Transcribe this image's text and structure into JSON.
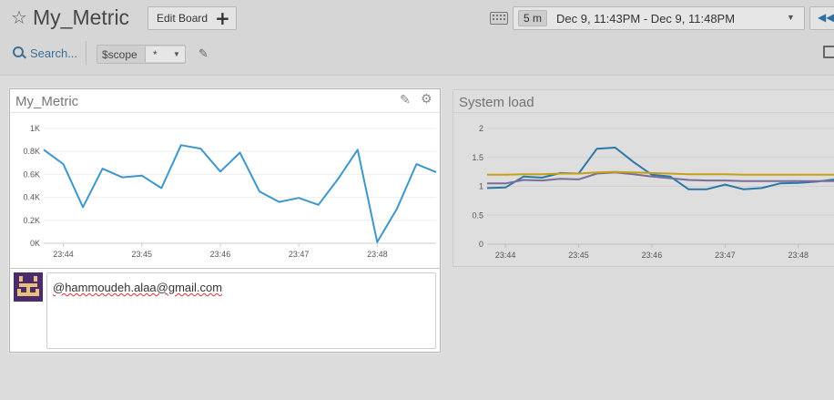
{
  "header": {
    "title": "My_Metric",
    "edit_board_label": "Edit Board",
    "time": {
      "duration": "5 m",
      "range": "Dec 9, 11:43PM - Dec 9, 11:48PM"
    }
  },
  "toolbar": {
    "search_label": "Search...",
    "template_var": {
      "name": "$scope",
      "value": "*"
    }
  },
  "widgets": [
    {
      "title": "My_Metric",
      "comment": {
        "text": "@hammoudeh.alaa@gmail.com"
      }
    },
    {
      "title": "System load"
    }
  ],
  "colors": {
    "line": "#3d97c9",
    "accent": "#2f6fa2"
  },
  "icons": [
    "star-icon",
    "plus-icon",
    "keyboard-icon",
    "chevron-down-icon",
    "rewind-icon",
    "search-icon",
    "pencil-icon",
    "gear-icon",
    "monitor-icon"
  ],
  "chart_data": [
    {
      "type": "line",
      "title": "My_Metric",
      "x": [
        "23:43:45",
        "23:44:00",
        "23:44:15",
        "23:44:30",
        "23:44:45",
        "23:45:00",
        "23:45:15",
        "23:45:30",
        "23:45:45",
        "23:46:00",
        "23:46:15",
        "23:46:30",
        "23:46:45",
        "23:47:00",
        "23:47:15",
        "23:47:30",
        "23:47:45",
        "23:48:00",
        "23:48:15",
        "23:48:30",
        "23:48:45"
      ],
      "xticks": [
        "23:44",
        "23:45",
        "23:46",
        "23:47",
        "23:48"
      ],
      "yticks": [
        "0K",
        "0.2K",
        "0.4K",
        "0.6K",
        "0.8K",
        "1K"
      ],
      "ylim": [
        0,
        1000
      ],
      "series": [
        {
          "values": [
            815,
            690,
            315,
            650,
            575,
            590,
            480,
            855,
            825,
            625,
            790,
            450,
            360,
            395,
            335,
            560,
            815,
            10,
            300,
            690,
            620
          ]
        }
      ],
      "grid": true
    },
    {
      "type": "line",
      "title": "System load",
      "x": [
        "23:43:45",
        "23:44:00",
        "23:44:15",
        "23:44:30",
        "23:44:45",
        "23:45:00",
        "23:45:15",
        "23:45:30",
        "23:45:45",
        "23:46:00",
        "23:46:15",
        "23:46:30",
        "23:46:45",
        "23:47:00",
        "23:47:15",
        "23:47:30",
        "23:47:45",
        "23:48:00",
        "23:48:15",
        "23:48:30"
      ],
      "xticks": [
        "23:44",
        "23:45",
        "23:46",
        "23:47",
        "23:48"
      ],
      "yticks": [
        "0",
        "0.5",
        "1",
        "1.5",
        "2"
      ],
      "ylim": [
        0,
        2
      ],
      "series": [
        {
          "color": "#2b78a8",
          "values": [
            0.97,
            0.98,
            1.17,
            1.15,
            1.23,
            1.22,
            1.65,
            1.67,
            1.42,
            1.2,
            1.17,
            0.95,
            0.95,
            1.03,
            0.95,
            0.97,
            1.05,
            1.06,
            1.08,
            1.12
          ]
        },
        {
          "color": "#7b6d9a",
          "values": [
            1.05,
            1.05,
            1.11,
            1.1,
            1.13,
            1.12,
            1.22,
            1.24,
            1.21,
            1.17,
            1.14,
            1.11,
            1.1,
            1.1,
            1.09,
            1.09,
            1.09,
            1.09,
            1.09,
            1.09
          ]
        },
        {
          "color": "#c7a017",
          "values": [
            1.2,
            1.2,
            1.21,
            1.21,
            1.22,
            1.22,
            1.24,
            1.25,
            1.24,
            1.23,
            1.22,
            1.21,
            1.21,
            1.21,
            1.2,
            1.2,
            1.2,
            1.2,
            1.2,
            1.2
          ]
        }
      ],
      "grid": true
    }
  ]
}
